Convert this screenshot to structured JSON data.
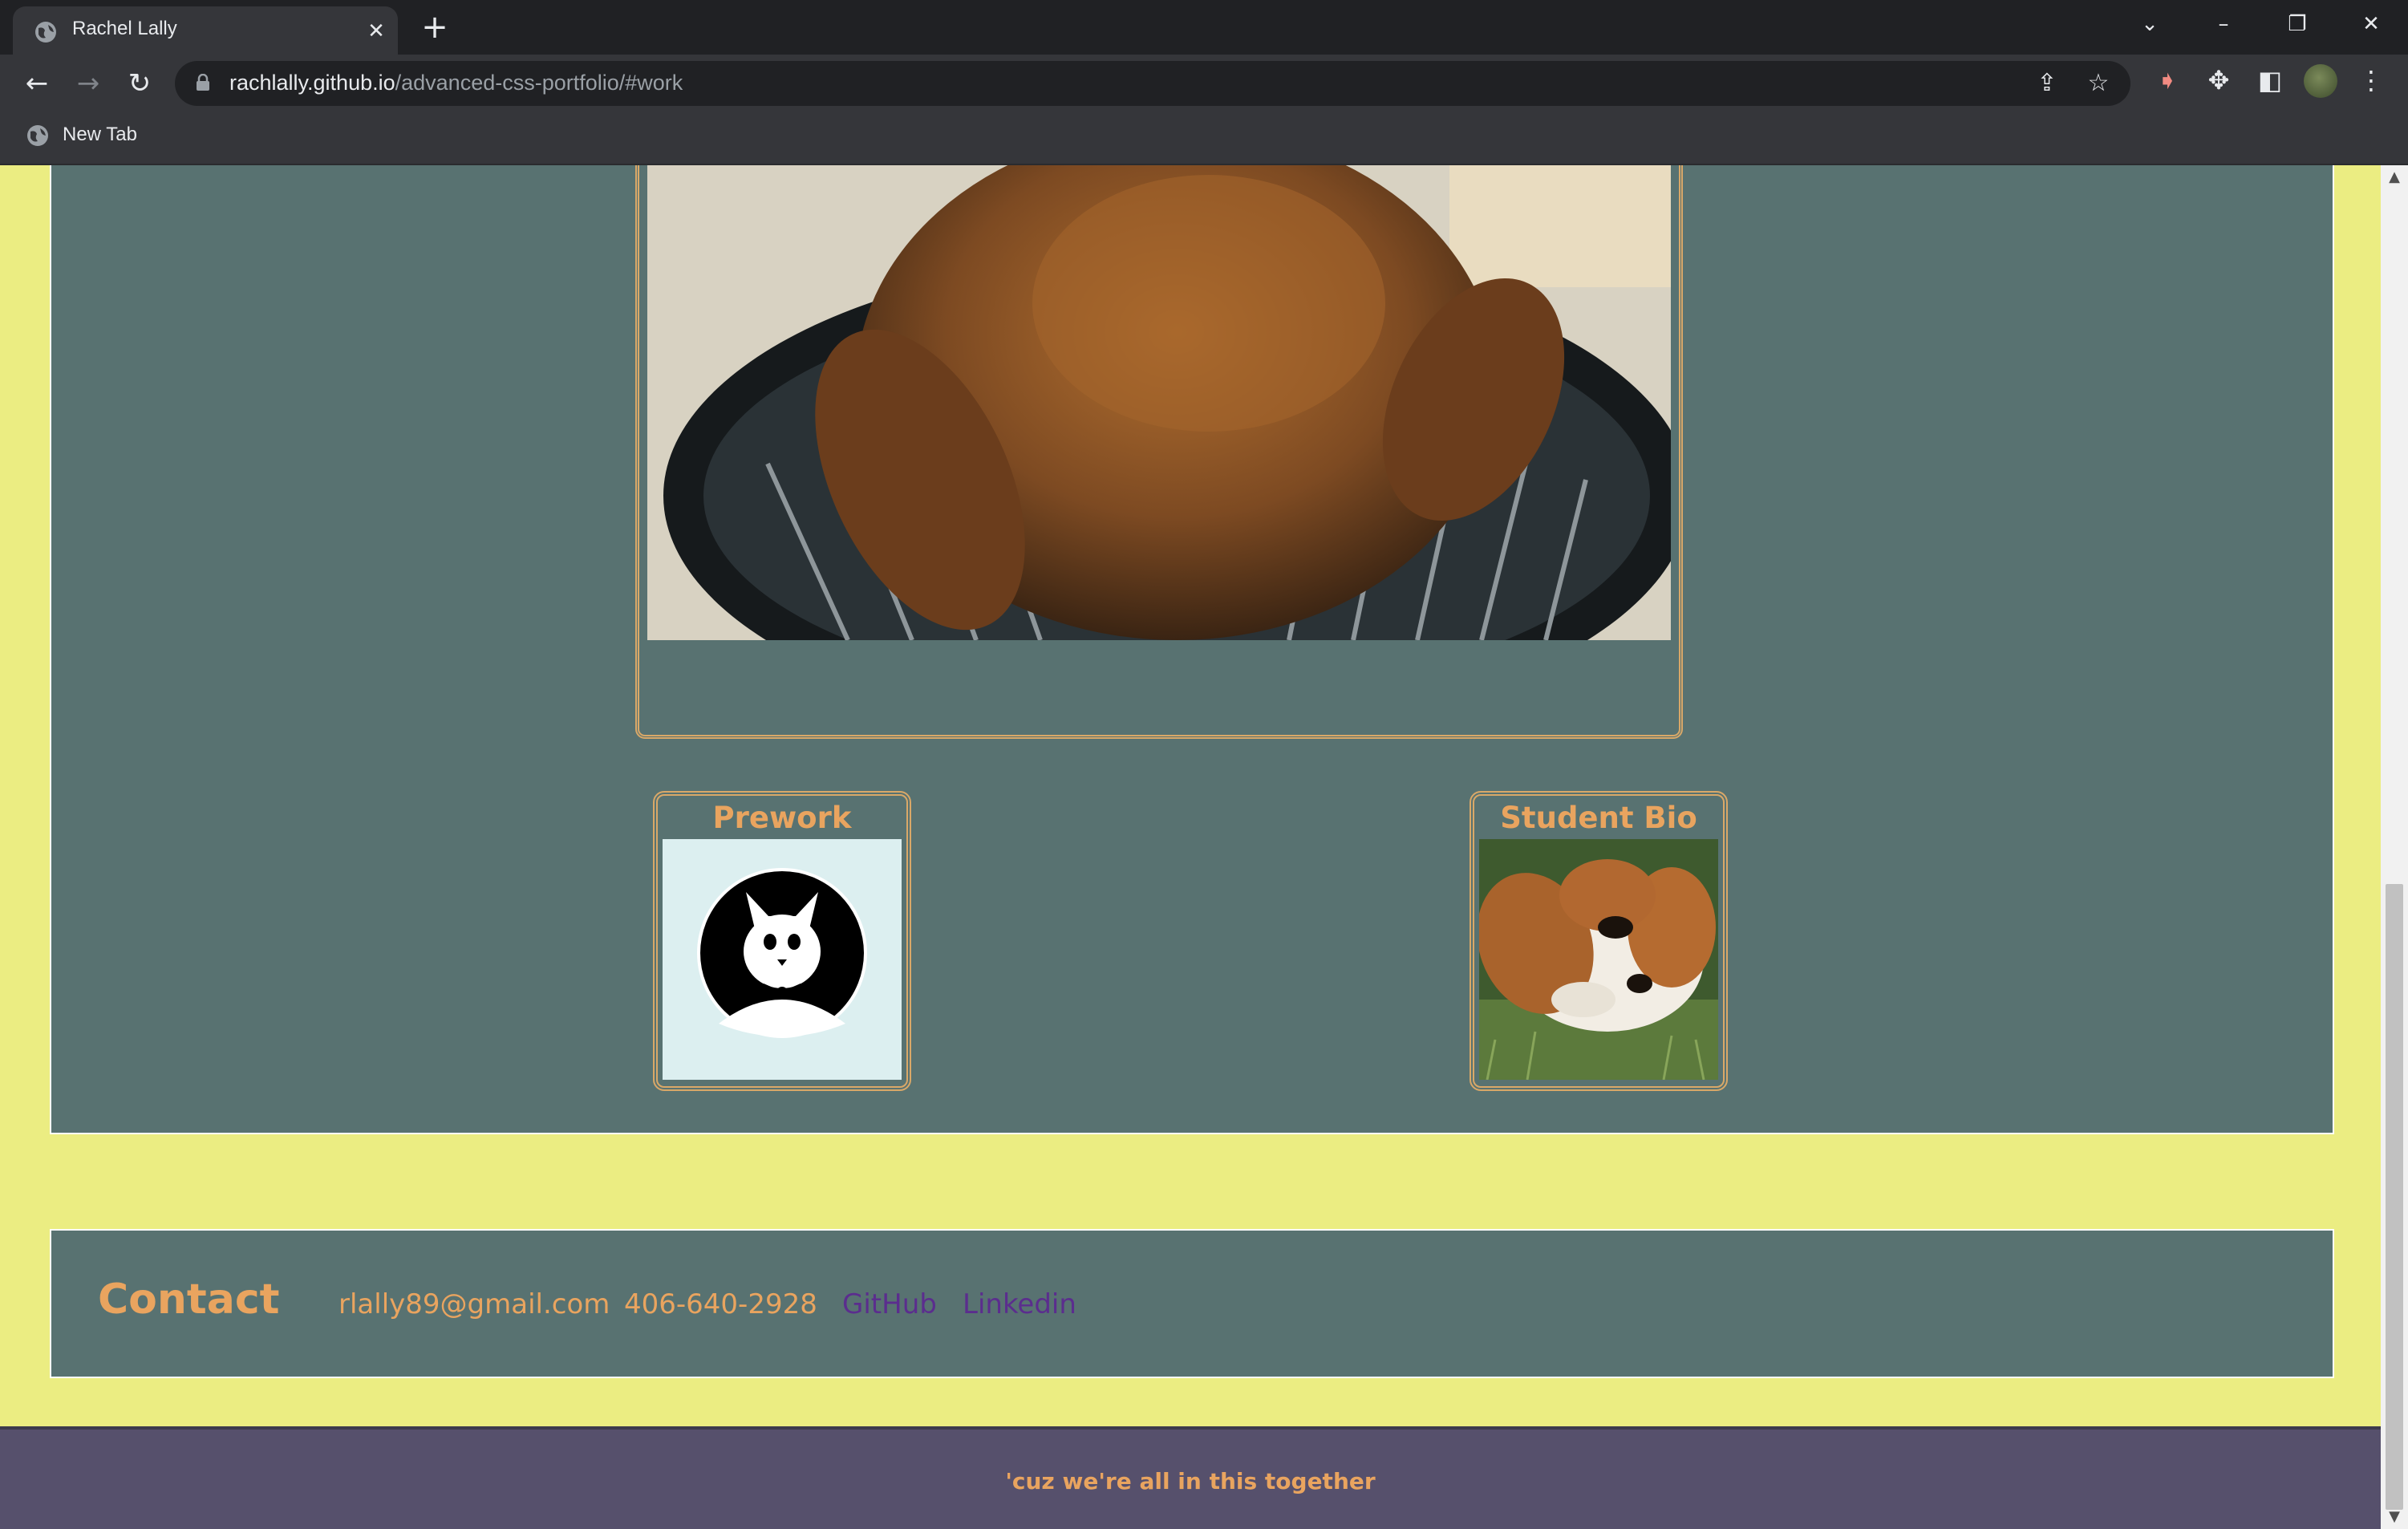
{
  "browser": {
    "tab_title": "Rachel Lally",
    "url_host": "rachlally.github.io",
    "url_path": "/advanced-css-portfolio/#work",
    "bookmark_label": "New Tab"
  },
  "work": {
    "featured_image_subject": "smoked turkey on grill",
    "cards": [
      {
        "title": "Prework",
        "image_subject": "cat with bow tie logo"
      },
      {
        "title": "Student Bio",
        "image_subject": "puppy lying in grass"
      }
    ]
  },
  "contact": {
    "heading": "Contact",
    "email": "rlally89@gmail.com",
    "phone": "406-640-2928",
    "links": [
      "GitHub",
      "Linkedin"
    ]
  },
  "footer": {
    "text": "'cuz we're all in this together"
  },
  "colors": {
    "page_background": "#ebed82",
    "section_background": "#587271",
    "accent": "#e9a45f",
    "link": "#5b2d8e",
    "footer_background": "#56506c"
  }
}
